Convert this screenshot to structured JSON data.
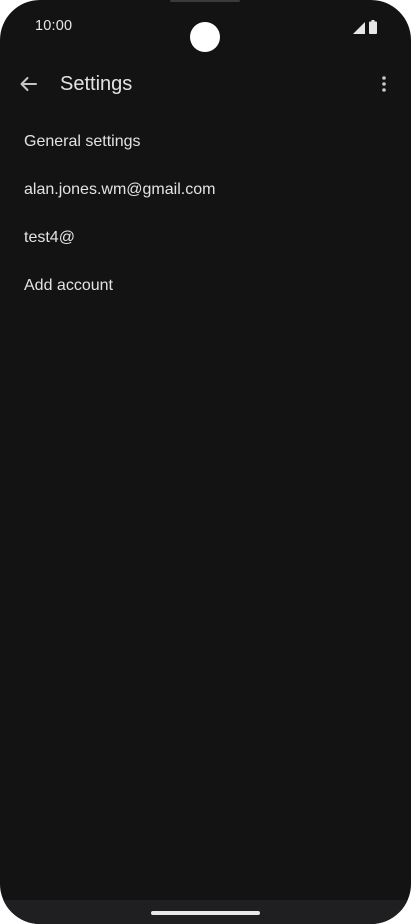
{
  "status_bar": {
    "time": "10:00"
  },
  "app_bar": {
    "title": "Settings",
    "back_icon": "arrow-back-icon",
    "menu_icon": "more-vert-icon"
  },
  "settings": {
    "items": [
      {
        "label": "General settings"
      },
      {
        "label": "alan.jones.wm@gmail.com"
      },
      {
        "label": "test4@"
      },
      {
        "label": "Add account"
      }
    ]
  },
  "colors": {
    "background": "#131314",
    "text": "#e3e3e3"
  }
}
